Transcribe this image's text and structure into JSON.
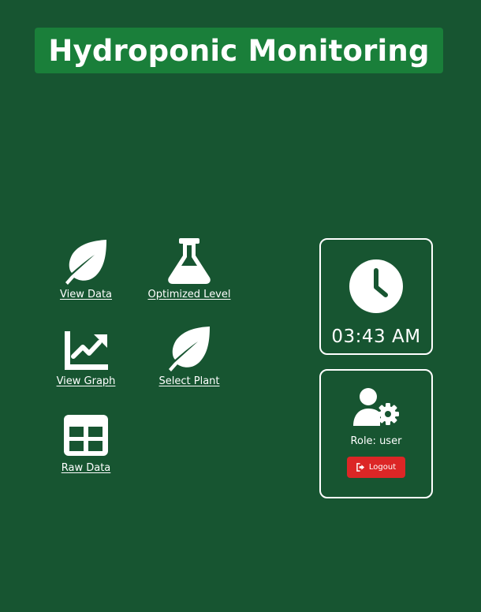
{
  "header": {
    "title": "Hydroponic Monitoring"
  },
  "menu": {
    "items": [
      {
        "label": "View Data",
        "icon": "leaf-icon"
      },
      {
        "label": "Optimized Level",
        "icon": "flask-icon"
      },
      {
        "label": "View Graph",
        "icon": "chart-line-icon"
      },
      {
        "label": "Select Plant",
        "icon": "leaf-icon"
      },
      {
        "label": "Raw Data",
        "icon": "table-icon"
      }
    ]
  },
  "clock": {
    "icon": "clock-icon",
    "time": "03:43 AM"
  },
  "user": {
    "icon": "user-gear-icon",
    "role_text": "Role: user",
    "logout_label": "Logout",
    "logout_icon": "sign-out-icon"
  },
  "colors": {
    "background": "#175531",
    "title_bar": "#1a7f3a",
    "logout_button": "#dc2626",
    "foreground": "#ffffff"
  }
}
